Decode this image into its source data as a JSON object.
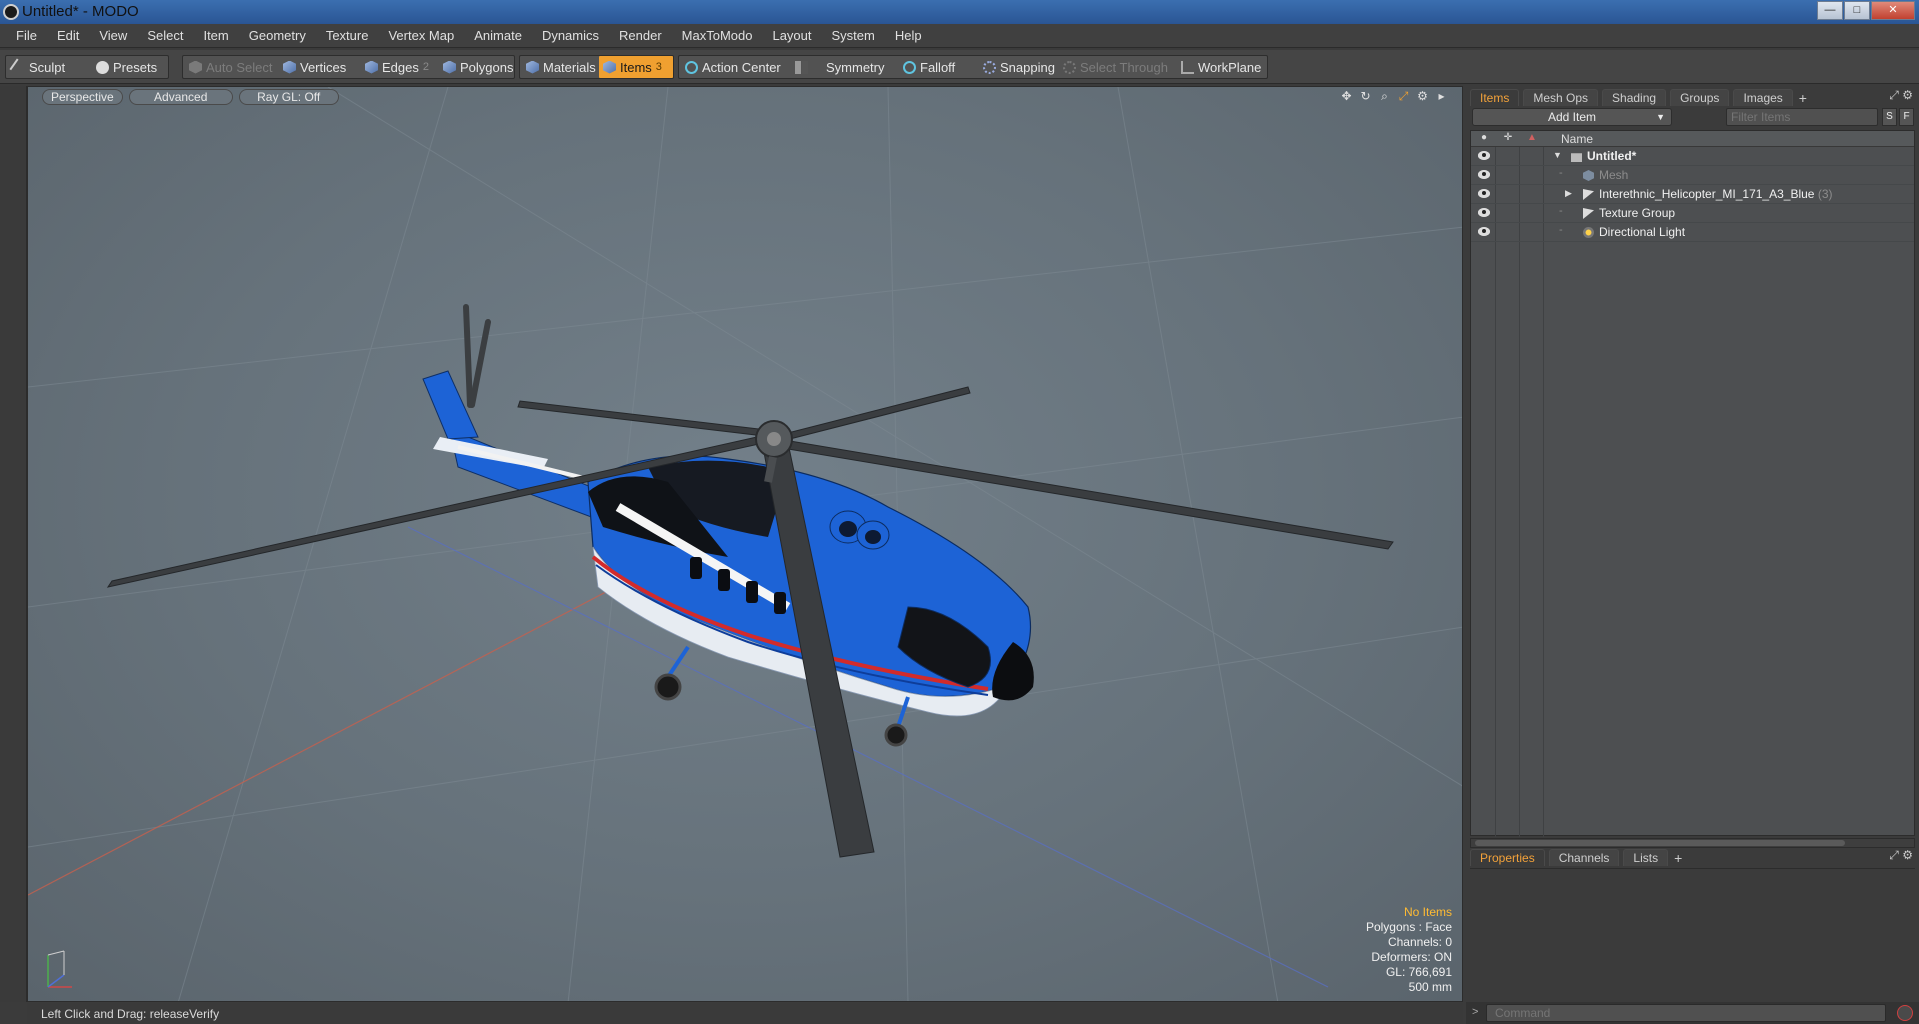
{
  "window": {
    "title": "Untitled* - MODO",
    "min": "—",
    "max": "□",
    "close": "✕"
  },
  "menu": [
    "File",
    "Edit",
    "View",
    "Select",
    "Item",
    "Geometry",
    "Texture",
    "Vertex Map",
    "Animate",
    "Dynamics",
    "Render",
    "MaxToModo",
    "Layout",
    "System",
    "Help"
  ],
  "toolbar": {
    "sculpt": "Sculpt",
    "presets": "Presets",
    "auto_select": "Auto Select",
    "vertices": "Vertices",
    "edges": "Edges",
    "edges_count": "2",
    "polygons": "Polygons",
    "materials": "Materials",
    "items": "Items",
    "items_count": "3",
    "action_center": "Action Center",
    "symmetry": "Symmetry",
    "falloff": "Falloff",
    "snapping": "Snapping",
    "select_through": "Select Through",
    "workplane": "WorkPlane"
  },
  "viewport": {
    "tabs": [
      "Perspective",
      "Advanced",
      "Ray GL: Off"
    ],
    "info": {
      "selection": "No Items",
      "polygons": "Polygons : Face",
      "channels": "Channels: 0",
      "deformers": "Deformers: ON",
      "gl": "GL: 766,691",
      "scale": "500 mm"
    },
    "accent_colors": {
      "rotor": "#3c3f42",
      "body": "#1d63d6",
      "stripe": "#d22b2b"
    }
  },
  "status": {
    "text": "Left Click and Drag:  releaseVerify"
  },
  "right_panel": {
    "top_tabs": [
      "Items",
      "Mesh Ops",
      "Shading",
      "Groups",
      "Images"
    ],
    "add_item": "Add Item",
    "filter_placeholder": "Filter Items",
    "btn_s": "S",
    "btn_f": "F",
    "column_name": "Name",
    "tree": [
      {
        "label": "Untitled*",
        "count": "",
        "icon": "scene-icon"
      },
      {
        "label": "Mesh",
        "count": "",
        "icon": "mesh-icon"
      },
      {
        "label": "Interethnic_Helicopter_MI_171_A3_Blue",
        "count": "(3)",
        "icon": "group-icon"
      },
      {
        "label": "Texture Group",
        "count": "",
        "icon": "group-icon"
      },
      {
        "label": "Directional Light",
        "count": "",
        "icon": "light-icon"
      }
    ],
    "bottom_tabs": [
      "Properties",
      "Channels",
      "Lists"
    ],
    "command_placeholder": "Command"
  }
}
